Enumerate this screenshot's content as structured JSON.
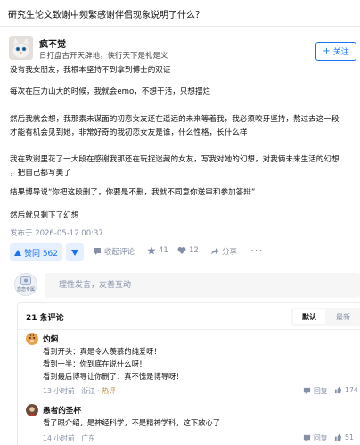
{
  "question": {
    "title": "研究生论文致谢中频繁感谢伴侣现象说明了什么？"
  },
  "author": {
    "name": "疯不觉",
    "bio": "日打盘古开天辟地，侠行天下是礼是义",
    "follow_label": "关注",
    "follow_icon": "plus-icon"
  },
  "answer": {
    "paragraphs": [
      "没有我女朋友，我根本坚持不到拿到博士的双证",
      "每次在压力山大的时候，我就会emo，不想干活，只想摆烂",
      "然后我就会想，我那素未谋面的初恋女友还在遥远的未来等着我，我必须咬牙坚持，熬过去这一段",
      "才能有机会见到她，非常好奇的我初恋女友是谁，什么性格，长什么样",
      "我在致谢里花了一大段在感谢我那还在玩捉迷藏的女友，写我对她的幻想，对我俩未来生活的幻想",
      "，把自己都写美了",
      "结果博导说“你把这段删了，你要是不删，我就不同意你送审和参加答辩”",
      "然后就只剩下了幻想"
    ],
    "publish_time": "发布于 2026-05-12 00:37"
  },
  "actions": {
    "upvote_label": "赞同 562",
    "collect_label": "收起评论",
    "like_count": "41",
    "comment_count": "12",
    "share_label": "分享",
    "more_label": "···"
  },
  "comment_box": {
    "placeholder": "理性发言，友善互动",
    "avatar_label": "恋恋专属"
  },
  "comments": {
    "count_label": "21 条评论",
    "sort_default": "默认",
    "sort_latest": "最新",
    "items": [
      {
        "name": "灼焖",
        "lines": [
          "看到开头：真是令人羡慕的纯爱呀！",
          "看到一半：你到底在说什么呀！",
          "看到最后博导让你删了：真不愧是博导呀！"
        ],
        "time": "13 小时前",
        "location": "浙江",
        "tag": "热评",
        "reply_label": "回复",
        "likes": "174"
      },
      {
        "name": "愚者的圣杯",
        "lines": [
          "看了眼介绍，是神经科学，不是精神学科，这下放心了"
        ],
        "time": "14 小时前",
        "location": "广东",
        "reply_label": "回复",
        "likes": "51"
      }
    ]
  },
  "colors": {
    "accent": "#1772f6",
    "upvote_bg": "#e5effd",
    "meta": "#8590a6",
    "hot_tag": "#b28c3a"
  }
}
